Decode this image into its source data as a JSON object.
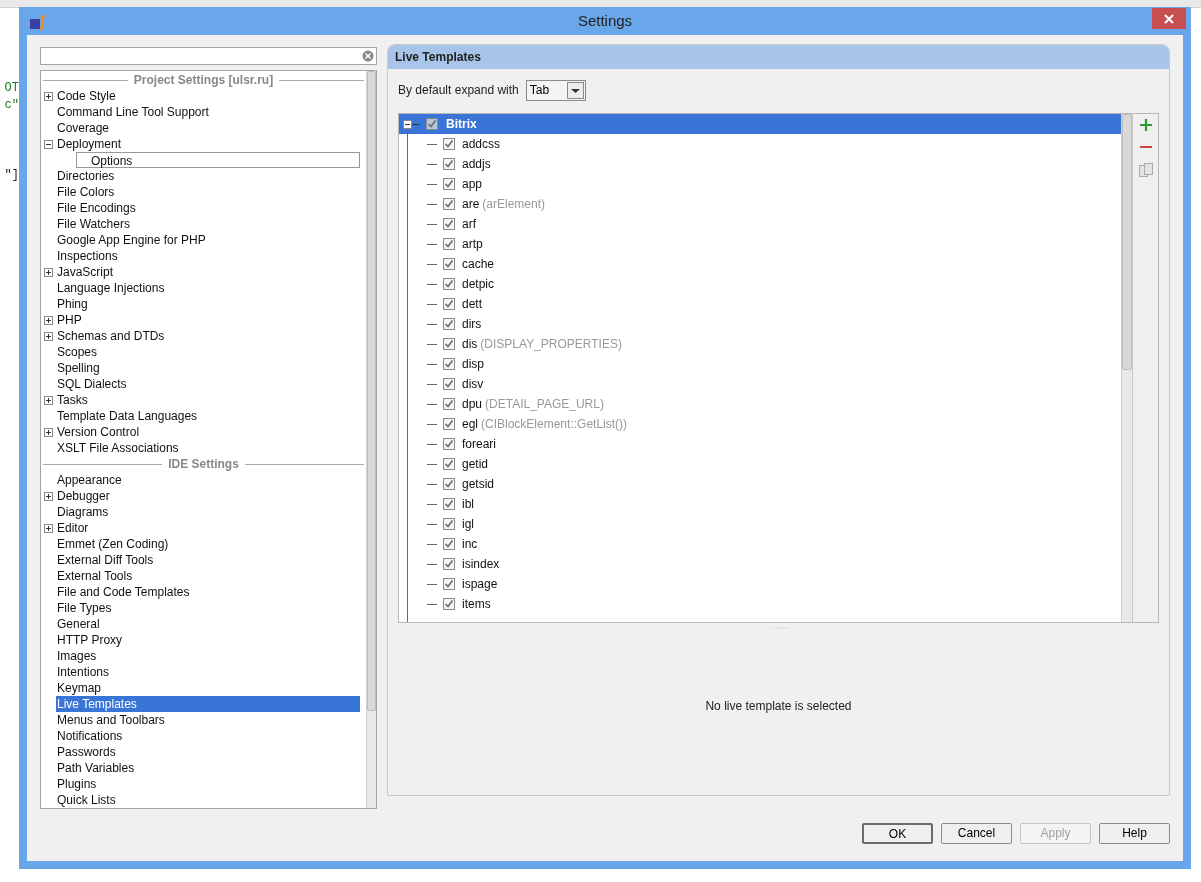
{
  "background": {
    "code_lines": [
      "OT",
      "c\"",
      "\"]"
    ]
  },
  "window": {
    "title": "Settings"
  },
  "sections": [
    {
      "title": "Project Settings [ulsr.ru]",
      "items": [
        {
          "label": "Code Style",
          "kind": "collapsed",
          "selected": false,
          "focused": false
        },
        {
          "label": "Command Line Tool Support",
          "kind": "leaf",
          "selected": false,
          "focused": false
        },
        {
          "label": "Coverage",
          "kind": "leaf",
          "selected": false,
          "focused": false
        },
        {
          "label": "Deployment",
          "kind": "expanded",
          "selected": false,
          "focused": false,
          "children": [
            {
              "label": "Options",
              "kind": "leaf",
              "selected": false,
              "focused": true
            }
          ]
        },
        {
          "label": "Directories",
          "kind": "leaf",
          "selected": false,
          "focused": false
        },
        {
          "label": "File Colors",
          "kind": "leaf",
          "selected": false,
          "focused": false
        },
        {
          "label": "File Encodings",
          "kind": "leaf",
          "selected": false,
          "focused": false
        },
        {
          "label": "File Watchers",
          "kind": "leaf",
          "selected": false,
          "focused": false
        },
        {
          "label": "Google App Engine for PHP",
          "kind": "leaf",
          "selected": false,
          "focused": false
        },
        {
          "label": "Inspections",
          "kind": "leaf",
          "selected": false,
          "focused": false
        },
        {
          "label": "JavaScript",
          "kind": "collapsed",
          "selected": false,
          "focused": false
        },
        {
          "label": "Language Injections",
          "kind": "leaf",
          "selected": false,
          "focused": false
        },
        {
          "label": "Phing",
          "kind": "leaf",
          "selected": false,
          "focused": false
        },
        {
          "label": "PHP",
          "kind": "collapsed",
          "selected": false,
          "focused": false
        },
        {
          "label": "Schemas and DTDs",
          "kind": "collapsed",
          "selected": false,
          "focused": false
        },
        {
          "label": "Scopes",
          "kind": "leaf",
          "selected": false,
          "focused": false
        },
        {
          "label": "Spelling",
          "kind": "leaf",
          "selected": false,
          "focused": false
        },
        {
          "label": "SQL Dialects",
          "kind": "leaf",
          "selected": false,
          "focused": false
        },
        {
          "label": "Tasks",
          "kind": "collapsed",
          "selected": false,
          "focused": false
        },
        {
          "label": "Template Data Languages",
          "kind": "leaf",
          "selected": false,
          "focused": false
        },
        {
          "label": "Version Control",
          "kind": "collapsed",
          "selected": false,
          "focused": false
        },
        {
          "label": "XSLT File Associations",
          "kind": "leaf",
          "selected": false,
          "focused": false
        }
      ]
    },
    {
      "title": "IDE Settings",
      "items": [
        {
          "label": "Appearance",
          "kind": "leaf",
          "selected": false,
          "focused": false
        },
        {
          "label": "Debugger",
          "kind": "collapsed",
          "selected": false,
          "focused": false
        },
        {
          "label": "Diagrams",
          "kind": "leaf",
          "selected": false,
          "focused": false
        },
        {
          "label": "Editor",
          "kind": "collapsed",
          "selected": false,
          "focused": false
        },
        {
          "label": "Emmet (Zen Coding)",
          "kind": "leaf",
          "selected": false,
          "focused": false
        },
        {
          "label": "External Diff Tools",
          "kind": "leaf",
          "selected": false,
          "focused": false
        },
        {
          "label": "External Tools",
          "kind": "leaf",
          "selected": false,
          "focused": false
        },
        {
          "label": "File and Code Templates",
          "kind": "leaf",
          "selected": false,
          "focused": false
        },
        {
          "label": "File Types",
          "kind": "leaf",
          "selected": false,
          "focused": false
        },
        {
          "label": "General",
          "kind": "leaf",
          "selected": false,
          "focused": false
        },
        {
          "label": "HTTP Proxy",
          "kind": "leaf",
          "selected": false,
          "focused": false
        },
        {
          "label": "Images",
          "kind": "leaf",
          "selected": false,
          "focused": false
        },
        {
          "label": "Intentions",
          "kind": "leaf",
          "selected": false,
          "focused": false
        },
        {
          "label": "Keymap",
          "kind": "leaf",
          "selected": false,
          "focused": false
        },
        {
          "label": "Live Templates",
          "kind": "leaf",
          "selected": true,
          "focused": false
        },
        {
          "label": "Menus and Toolbars",
          "kind": "leaf",
          "selected": false,
          "focused": false
        },
        {
          "label": "Notifications",
          "kind": "leaf",
          "selected": false,
          "focused": false
        },
        {
          "label": "Passwords",
          "kind": "leaf",
          "selected": false,
          "focused": false
        },
        {
          "label": "Path Variables",
          "kind": "leaf",
          "selected": false,
          "focused": false
        },
        {
          "label": "Plugins",
          "kind": "leaf",
          "selected": false,
          "focused": false
        },
        {
          "label": "Quick Lists",
          "kind": "leaf",
          "selected": false,
          "focused": false
        }
      ]
    }
  ],
  "panel": {
    "title": "Live Templates",
    "expand_label": "By default expand with",
    "expand_value": "Tab",
    "group": {
      "name": "Bitrix",
      "checked": true,
      "expanded": true,
      "selected": true,
      "templates": [
        {
          "abbr": "addcss",
          "checked": true
        },
        {
          "abbr": "addjs",
          "checked": true
        },
        {
          "abbr": "app",
          "checked": true
        },
        {
          "abbr": "are",
          "description": "(arElement)",
          "checked": true
        },
        {
          "abbr": "arf",
          "checked": true
        },
        {
          "abbr": "artp",
          "checked": true
        },
        {
          "abbr": "cache",
          "checked": true
        },
        {
          "abbr": "detpic",
          "checked": true
        },
        {
          "abbr": "dett",
          "checked": true
        },
        {
          "abbr": "dirs",
          "checked": true
        },
        {
          "abbr": "dis",
          "description": "(DISPLAY_PROPERTIES)",
          "checked": true
        },
        {
          "abbr": "disp",
          "checked": true
        },
        {
          "abbr": "disv",
          "checked": true
        },
        {
          "abbr": "dpu",
          "description": "(DETAIL_PAGE_URL)",
          "checked": true
        },
        {
          "abbr": "egl",
          "description": "(CIBlockElement::GetList())",
          "checked": true
        },
        {
          "abbr": "foreari",
          "checked": true
        },
        {
          "abbr": "getid",
          "checked": true
        },
        {
          "abbr": "getsid",
          "checked": true
        },
        {
          "abbr": "ibl",
          "checked": true
        },
        {
          "abbr": "igl",
          "checked": true
        },
        {
          "abbr": "inc",
          "checked": true
        },
        {
          "abbr": "isindex",
          "checked": true
        },
        {
          "abbr": "ispage",
          "checked": true
        },
        {
          "abbr": "items",
          "checked": true
        }
      ]
    },
    "empty_message": "No live template is selected"
  },
  "buttons": [
    {
      "label": "OK",
      "kind": "default",
      "disabled": false
    },
    {
      "label": "Cancel",
      "kind": "normal",
      "disabled": false
    },
    {
      "label": "Apply",
      "kind": "normal",
      "disabled": true
    },
    {
      "label": "Help",
      "kind": "normal",
      "disabled": false
    }
  ]
}
